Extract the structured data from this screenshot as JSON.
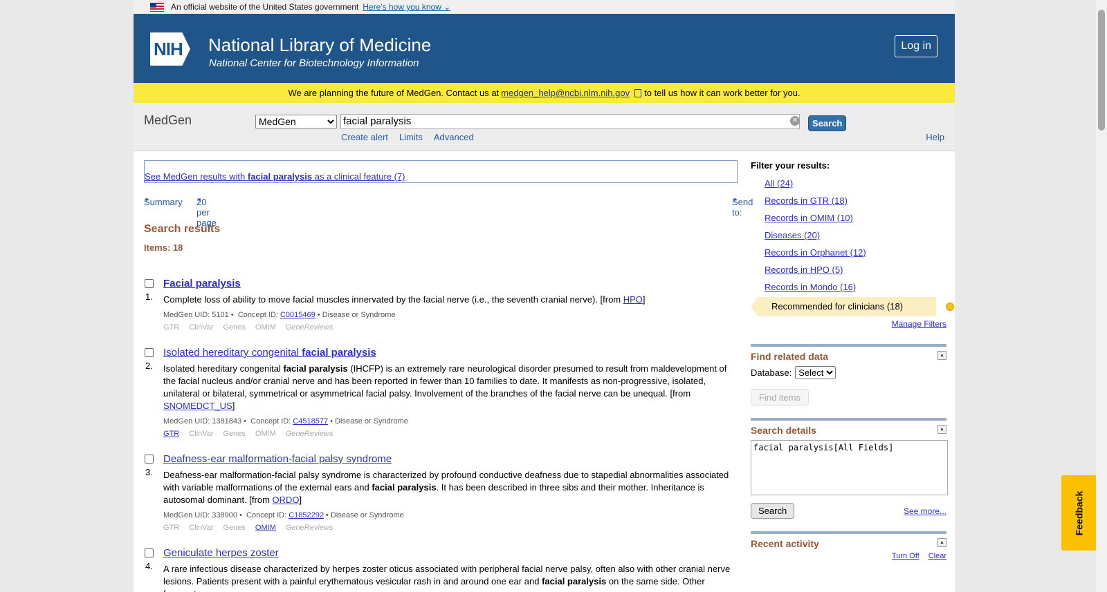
{
  "gov_banner": {
    "text": "An official website of the United States government",
    "link": "Here's how you know"
  },
  "header": {
    "logo": "NIH",
    "title": "National Library of Medicine",
    "subtitle": "National Center for Biotechnology Information",
    "login": "Log in"
  },
  "notice": {
    "before": "We are planning the future of MedGen. Contact us at",
    "email": "medgen_help@ncbi.nlm.nih.gov",
    "after": "to tell us how it can work better for you."
  },
  "search": {
    "db_name": "MedGen",
    "db_select": "MedGen",
    "term": "facial paralysis",
    "button": "Search",
    "links": [
      "Create alert",
      "Limits",
      "Advanced"
    ],
    "help": "Help"
  },
  "main": {
    "clinical_pre": "See MedGen results with",
    "clinical_bold": "facial paralysis",
    "clinical_post": "as a clinical feature (7)",
    "format": "Summary",
    "per_page": "20 per page",
    "send_to": "Send to:",
    "results_title": "Search results",
    "items": "Items: 18"
  },
  "results": [
    {
      "num": "1.",
      "title": "Facial paralysis",
      "desc": "Complete loss of ability to move facial muscles innervated by the facial nerve (i.e., the seventh cranial nerve). [from ",
      "source": "HPO",
      "desc_end": "]",
      "uid": "MedGen UID: 5101 •",
      "cid_label": "Concept ID:",
      "cid": "C0015469",
      "type": "• Disease or Syndrome"
    },
    {
      "num": "2.",
      "title_pre": "Isolated hereditary congenital",
      "title_bold": "facial paralysis",
      "desc_a": "Isolated hereditary congenital",
      "desc_bold": "facial paralysis",
      "desc_b": "(IHCFP) is an extremely rare neurological disorder presumed to result from maldevelopment of the facial nucleus and/or cranial nerve and has been reported in fewer than 10 families to date. It manifests as non-progressive, isolated, unilateral or bilateral, symmetrical or asymmetrical facial palsy. Involvement of the branches of the facial nerve can be unequal. [from",
      "source": "SNOMEDCT_US",
      "desc_end": "]",
      "uid": "MedGen UID: 1381843 •",
      "cid_label": "Concept ID:",
      "cid": "C4518577",
      "type": "• Disease or Syndrome"
    },
    {
      "num": "3.",
      "title": "Deafness-ear malformation-facial palsy syndrome",
      "desc_a": "Deafness-ear malformation-facial palsy syndrome is characterized by profound conductive deafness due to stapedial abnormalities associated with variable malformations of the external ears and",
      "desc_bold": "facial paralysis",
      "desc_b": ". It has been described in three sibs and their mother. Inheritance is autosomal dominant. [from",
      "source": "ORDO",
      "desc_end": "]",
      "uid": "MedGen UID: 338900 •",
      "cid_label": "Concept ID:",
      "cid": "C1852292",
      "type": "• Disease or Syndrome"
    },
    {
      "num": "4.",
      "title": "Geniculate herpes zoster",
      "desc_a": "A rare infectious disease characterized by herpes zoster oticus associated with peripheral facial nerve palsy, often also with other cranial nerve lesions. Patients present with a painful erythematous vesicular rash in and around one ear and",
      "desc_bold": "facial paralysis",
      "desc_b": "on the same side. Other frequent"
    }
  ],
  "result_links": [
    "GTR",
    "ClinVar",
    "Genes",
    "OMIM",
    "GeneReviews"
  ],
  "side": {
    "filter_head": "Filter your results:",
    "filters": [
      "All (24)",
      "Records in GTR (18)",
      "Records in OMIM (10)",
      "Diseases (20)",
      "Records in Orphanet (12)",
      "Records in HPO (5)",
      "Records in Mondo (16)"
    ],
    "recommended": "Recommended for clinicians (18)",
    "manage": "Manage Filters",
    "find_related": "Find related data",
    "database_label": "Database:",
    "database_select": "Select",
    "find_items": "Find items",
    "search_details": "Search details",
    "details_query": "facial paralysis[All Fields]",
    "details_search": "Search",
    "see_more": "See more...",
    "recent": "Recent activity",
    "turn_off": "Turn Off",
    "clear": "Clear"
  },
  "feedback": "Feedback"
}
